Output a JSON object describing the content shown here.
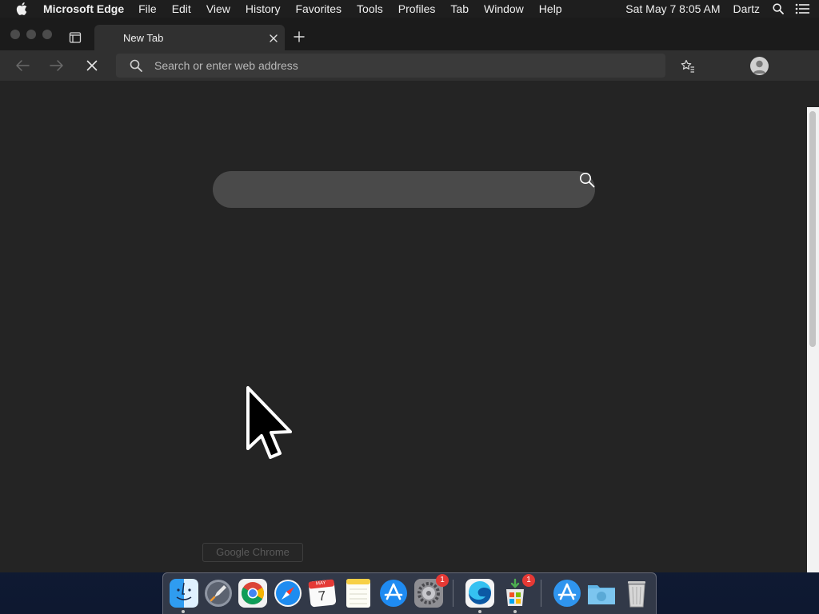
{
  "menubar": {
    "app_name": "Microsoft Edge",
    "items": [
      "File",
      "Edit",
      "View",
      "History",
      "Favorites",
      "Tools",
      "Profiles",
      "Tab",
      "Window",
      "Help"
    ],
    "clock": "Sat May 7  8:05 AM",
    "user": "Dartz"
  },
  "browser": {
    "tab": {
      "title": "New Tab"
    },
    "address_bar": {
      "placeholder": "Search or enter web address",
      "value": ""
    },
    "ntp_search": {
      "value": ""
    }
  },
  "tooltip": {
    "text": "Google Chrome"
  },
  "dock": {
    "apps": [
      {
        "name": "Finder",
        "running": true
      },
      {
        "name": "Launchpad",
        "running": false
      },
      {
        "name": "Google Chrome",
        "running": false
      },
      {
        "name": "Safari",
        "running": false
      },
      {
        "name": "Calendar",
        "running": false,
        "month": "MAY",
        "day": "7"
      },
      {
        "name": "Notes",
        "running": false
      },
      {
        "name": "App Store",
        "running": false
      },
      {
        "name": "System Preferences",
        "running": false,
        "badge": "1"
      },
      {
        "name": "Microsoft Edge",
        "running": true
      },
      {
        "name": "Microsoft Store Installer",
        "running": true,
        "badge": "1"
      },
      {
        "name": "App Store Downloads",
        "running": false
      },
      {
        "name": "Downloads",
        "running": false
      },
      {
        "name": "Trash",
        "running": false
      }
    ]
  },
  "colors": {
    "menubar_bg": "#1e1e1e",
    "tabstrip_bg": "#1b1b1b",
    "toolbar_bg": "#303030",
    "content_bg": "#242424",
    "ntp_search_bg": "#4a4a4a",
    "badge": "#e53935"
  }
}
